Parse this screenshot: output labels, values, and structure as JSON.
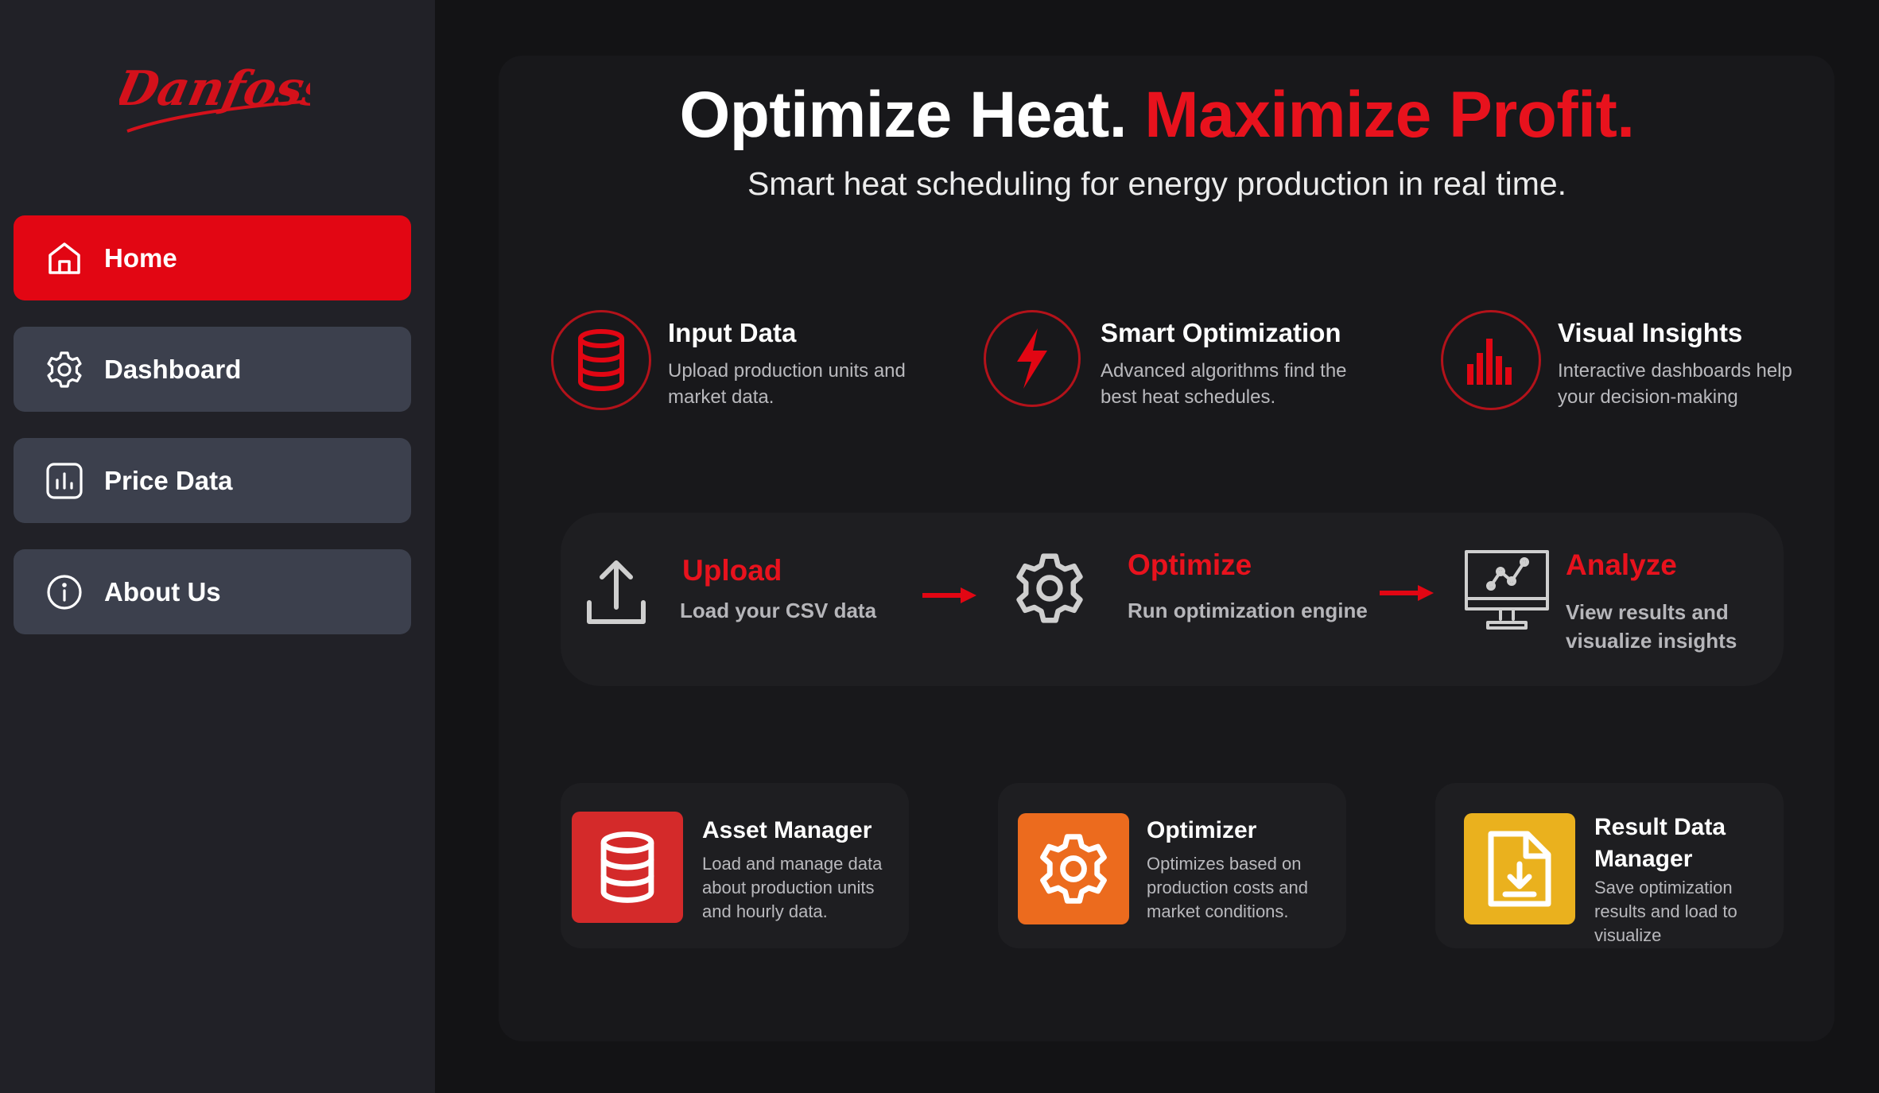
{
  "brand": {
    "logo_text": "Danfoss",
    "accent": "#e20613",
    "nav_inactive": "#3c404d",
    "sidebar_bg": "#212127"
  },
  "sidebar": {
    "items": [
      {
        "label": "Home",
        "icon": "home-icon",
        "active": true
      },
      {
        "label": "Dashboard",
        "icon": "gear-icon",
        "active": false
      },
      {
        "label": "Price Data",
        "icon": "bar-chart-icon",
        "active": false
      },
      {
        "label": "About Us",
        "icon": "info-icon",
        "active": false
      }
    ]
  },
  "hero": {
    "title_white": "Optimize Heat.",
    "title_red": "Maximize Profit.",
    "subtitle": "Smart heat scheduling for energy production in real time."
  },
  "features": [
    {
      "title": "Input Data",
      "desc": "Upload production units and market data.",
      "icon": "database-icon"
    },
    {
      "title": "Smart Optimization",
      "desc": "Advanced algorithms find the best heat schedules.",
      "icon": "lightning-icon"
    },
    {
      "title": "Visual Insights",
      "desc": "Interactive dashboards help your decision-making",
      "icon": "bar-chart-icon"
    }
  ],
  "process": [
    {
      "title": "Upload",
      "desc": "Load your CSV data",
      "icon": "upload-icon"
    },
    {
      "title": "Optimize",
      "desc": "Run optimization engine",
      "icon": "gear-icon"
    },
    {
      "title": "Analyze",
      "desc": "View results and visualize insights",
      "icon": "monitor-chart-icon"
    }
  ],
  "modules": [
    {
      "title": "Asset Manager",
      "desc": "Load and manage data about production units and hourly data.",
      "icon": "database-icon",
      "color": "#d42a2a"
    },
    {
      "title": "Optimizer",
      "desc": "Optimizes based on production costs and market conditions.",
      "icon": "gear-icon",
      "color": "#ec6b1e"
    },
    {
      "title": "Result Data Manager",
      "desc": "Save optimization results and load to visualize",
      "icon": "file-download-icon",
      "color": "#eab11e"
    }
  ]
}
